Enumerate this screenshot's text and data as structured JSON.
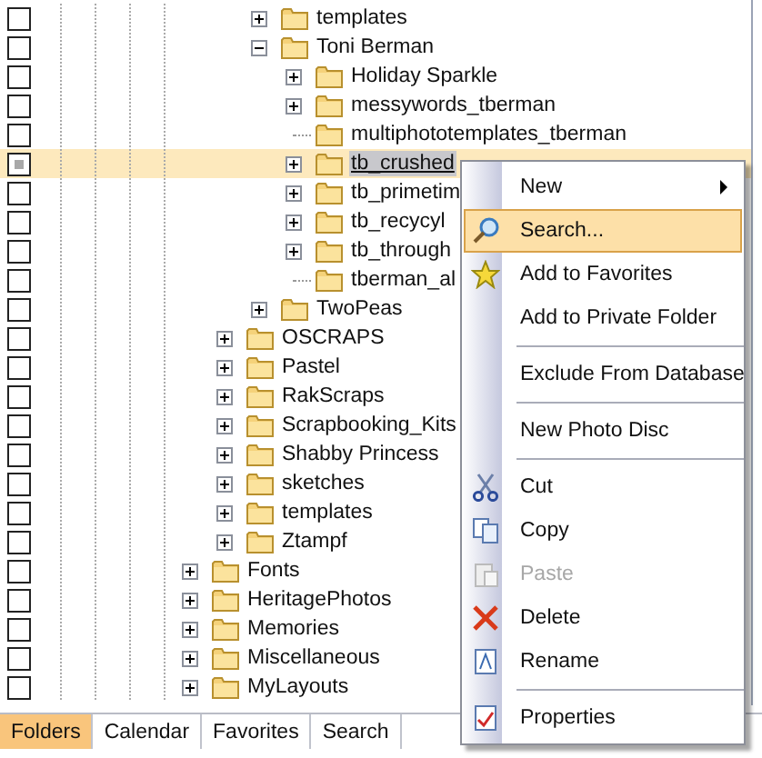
{
  "tree": [
    {
      "children": [
        {
          "children": [
            {
              "label": "templates",
              "expanded": false,
              "partial": false,
              "selected": false
            },
            {
              "label": "Toni Berman",
              "expanded": true,
              "partial": false,
              "selected": false,
              "children": [
                {
                  "label": "Holiday Sparkle",
                  "expanded": false,
                  "partial": false,
                  "selected": false
                },
                {
                  "label": "messywords_tberman",
                  "expanded": false,
                  "partial": false,
                  "selected": false
                },
                {
                  "label": "multiphototemplates_tberman",
                  "partial": false,
                  "selected": false
                },
                {
                  "label": "tb_crushed",
                  "expanded": false,
                  "partial": true,
                  "selected": true
                },
                {
                  "label": "tb_primetim",
                  "expanded": false,
                  "partial": false,
                  "selected": false
                },
                {
                  "label": "tb_recycyl",
                  "expanded": false,
                  "partial": false,
                  "selected": false
                },
                {
                  "label": "tb_through",
                  "expanded": false,
                  "partial": false,
                  "selected": false
                },
                {
                  "label": "tberman_al",
                  "partial": false,
                  "selected": false
                }
              ]
            },
            {
              "label": "TwoPeas",
              "expanded": false,
              "partial": false,
              "selected": false
            }
          ]
        },
        {
          "label": "OSCRAPS",
          "expanded": false,
          "partial": false,
          "selected": false
        },
        {
          "label": "Pastel",
          "expanded": false,
          "partial": false,
          "selected": false
        },
        {
          "label": "RakScraps",
          "expanded": false,
          "partial": false,
          "selected": false
        },
        {
          "label": "Scrapbooking_Kits",
          "expanded": false,
          "partial": false,
          "selected": false
        },
        {
          "label": "Shabby Princess",
          "expanded": false,
          "partial": false,
          "selected": false
        },
        {
          "label": "sketches",
          "expanded": false,
          "partial": false,
          "selected": false
        },
        {
          "label": "templates",
          "expanded": false,
          "partial": false,
          "selected": false
        },
        {
          "label": "Ztampf",
          "expanded": false,
          "partial": false,
          "selected": false
        }
      ]
    },
    {
      "label": "Fonts",
      "expanded": false,
      "partial": false,
      "selected": false
    },
    {
      "label": "HeritagePhotos",
      "expanded": false,
      "partial": false,
      "selected": false
    },
    {
      "label": "Memories",
      "expanded": false,
      "partial": false,
      "selected": false
    },
    {
      "label": "Miscellaneous",
      "expanded": false,
      "partial": false,
      "selected": false
    },
    {
      "label": "MyLayouts",
      "expanded": false,
      "partial": false,
      "selected": false
    }
  ],
  "context_menu": [
    {
      "kind": "submenu",
      "label": "New",
      "selected": false,
      "disabled": false
    },
    {
      "kind": "search",
      "label": "Search...",
      "selected": true,
      "disabled": false
    },
    {
      "kind": "star",
      "label": "Add to Favorites",
      "selected": false,
      "disabled": false
    },
    {
      "kind": "plain",
      "label": "Add to Private Folder",
      "selected": false,
      "disabled": false
    },
    {
      "kind": "separator"
    },
    {
      "kind": "plain",
      "label": "Exclude From Database",
      "selected": false,
      "disabled": false
    },
    {
      "kind": "separator"
    },
    {
      "kind": "plain",
      "label": "New Photo Disc",
      "selected": false,
      "disabled": false
    },
    {
      "kind": "separator"
    },
    {
      "kind": "cut",
      "label": "Cut",
      "selected": false,
      "disabled": false
    },
    {
      "kind": "copy",
      "label": "Copy",
      "selected": false,
      "disabled": false
    },
    {
      "kind": "paste",
      "label": "Paste",
      "selected": false,
      "disabled": true
    },
    {
      "kind": "delete",
      "label": "Delete",
      "selected": false,
      "disabled": false
    },
    {
      "kind": "rename",
      "label": "Rename",
      "selected": false,
      "disabled": false
    },
    {
      "kind": "separator"
    },
    {
      "kind": "properties",
      "label": "Properties",
      "selected": false,
      "disabled": false
    }
  ],
  "tabs": [
    {
      "label": "Folders",
      "selected": true
    },
    {
      "label": "Calendar",
      "selected": false
    },
    {
      "label": "Favorites",
      "selected": false
    },
    {
      "label": "Search",
      "selected": false
    }
  ]
}
